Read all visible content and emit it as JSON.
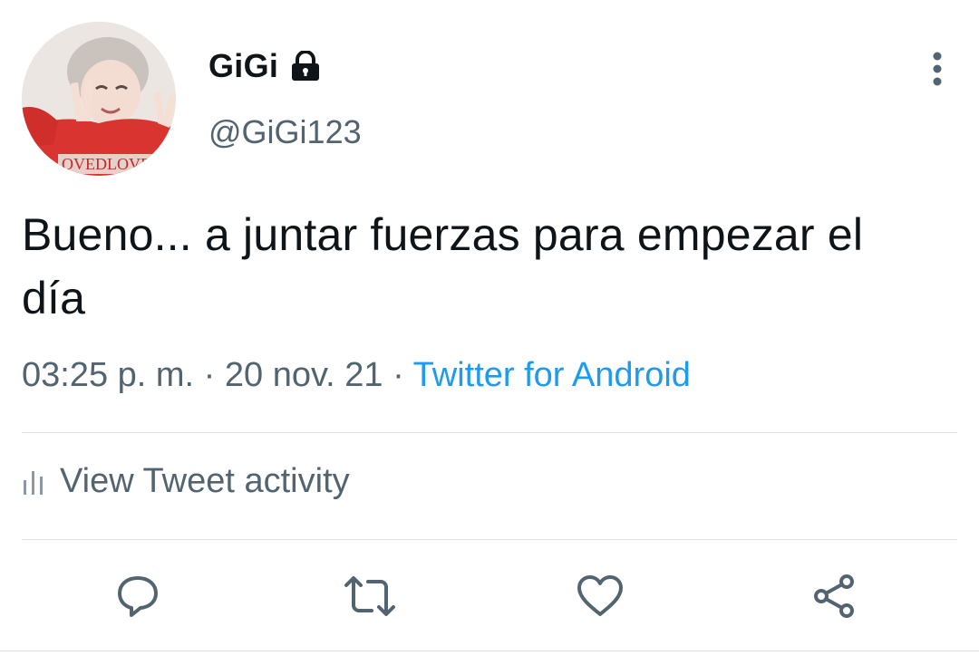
{
  "user": {
    "display_name": "GiGi",
    "handle": "@GiGi123",
    "avatar_shirt_text": "OVEDLOVE",
    "locked_icon": "lock-icon"
  },
  "tweet": {
    "text": "Bueno... a juntar fuerzas para empezar el día",
    "time": "03:25 p. m.",
    "separator": " · ",
    "date": "20 nov. 21",
    "source": "Twitter for Android"
  },
  "activity": {
    "label": "View Tweet activity",
    "icon": "bar-chart-icon"
  },
  "actions": {
    "reply_icon": "reply-icon",
    "retweet_icon": "retweet-icon",
    "like_icon": "heart-icon",
    "share_icon": "share-icon"
  },
  "colors": {
    "text_primary": "#0f1419",
    "text_secondary": "#536471",
    "link": "#1d9bf0",
    "divider": "#dfe3e6"
  }
}
